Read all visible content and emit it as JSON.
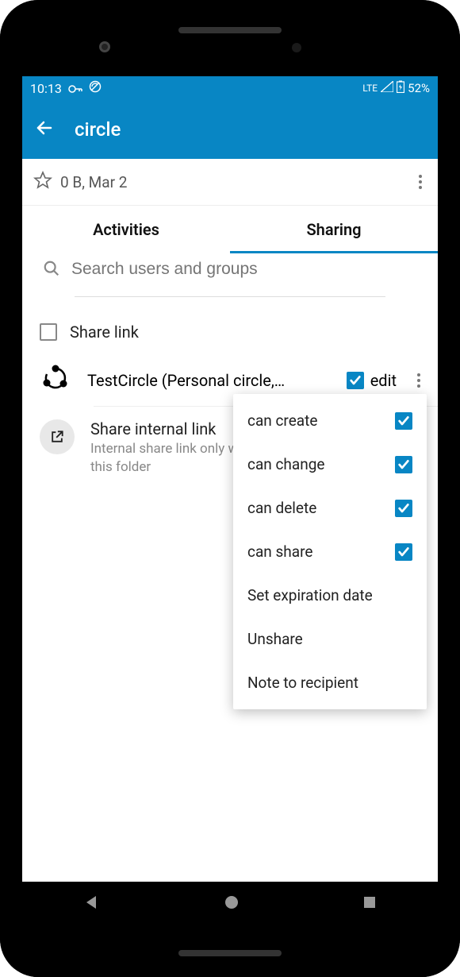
{
  "status": {
    "time": "10:13",
    "network": "LTE",
    "battery": "52%"
  },
  "header": {
    "title": "circle"
  },
  "file": {
    "meta": "0 B, Mar 2"
  },
  "tabs": {
    "activities": "Activities",
    "sharing": "Sharing",
    "active": "sharing"
  },
  "search": {
    "placeholder": "Search users and groups"
  },
  "shareLink": {
    "label": "Share link",
    "checked": false
  },
  "shareEntry": {
    "name": "TestCircle (Personal circle,…",
    "editLabel": "edit",
    "editChecked": true
  },
  "internal": {
    "title": "Share internal link",
    "subtitle": "Internal share link only works for users with access to this folder"
  },
  "popup": {
    "items": [
      {
        "label": "can create",
        "checked": true
      },
      {
        "label": "can change",
        "checked": true
      },
      {
        "label": "can delete",
        "checked": true
      },
      {
        "label": "can share",
        "checked": true
      },
      {
        "label": "Set expiration date"
      },
      {
        "label": "Unshare"
      },
      {
        "label": "Note to recipient"
      }
    ]
  }
}
